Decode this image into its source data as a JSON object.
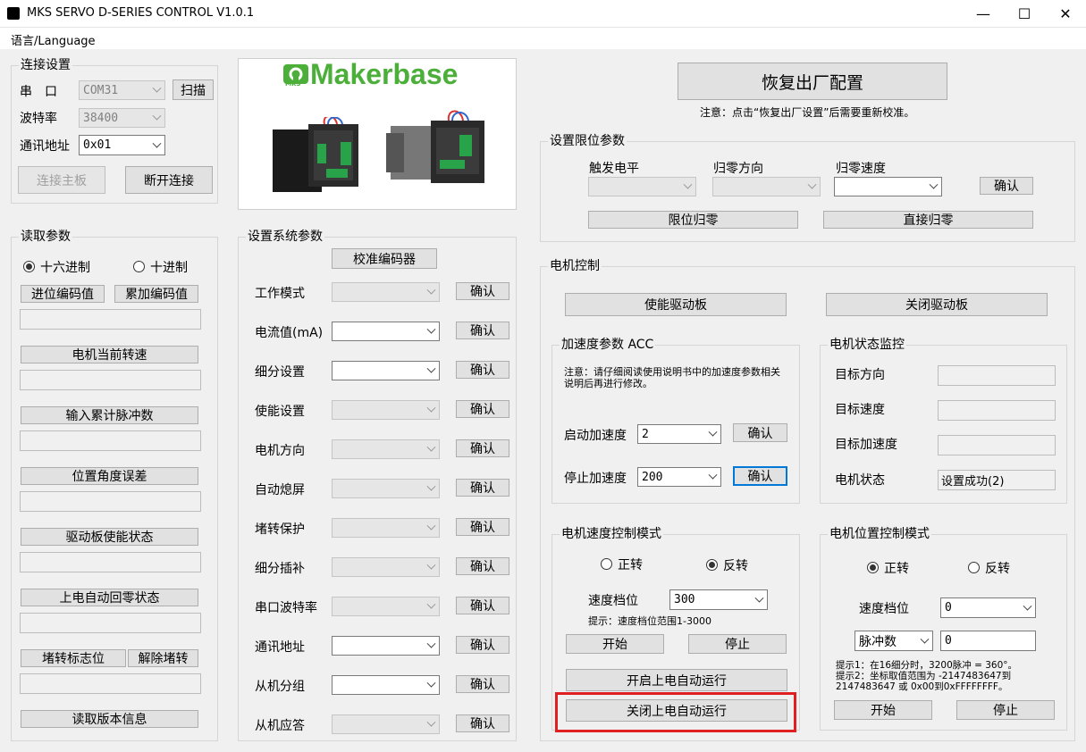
{
  "window": {
    "title": "MKS SERVO D-SERIES CONTROL V1.0.1",
    "minimize": "—",
    "maximize": "☐",
    "close": "✕"
  },
  "menu": {
    "language": "语言/Language"
  },
  "connection": {
    "group_label": "连接设置",
    "port_label": "串　口",
    "port_value": "COM31",
    "scan_button": "扫描",
    "baud_label": "波特率",
    "baud_value": "38400",
    "addr_label": "通讯地址",
    "addr_value": "0x01",
    "connect_button": "连接主板",
    "disconnect_button": "断开连接"
  },
  "logo": {
    "brand": "Makerbase",
    "badge": "MKS"
  },
  "read_params": {
    "group_label": "读取参数",
    "hex_label": "十六进制",
    "dec_label": "十进制",
    "carry_button": "进位编码值",
    "accum_button": "累加编码值",
    "speed_button": "电机当前转速",
    "pulses_button": "输入累计脉冲数",
    "angle_err_button": "位置角度误差",
    "enable_state_button": "驱动板使能状态",
    "auto_home_button": "上电自动回零状态",
    "stall_flag_button": "堵转标志位",
    "release_stall_button": "解除堵转",
    "version_button": "读取版本信息"
  },
  "system_params": {
    "group_label": "设置系统参数",
    "calibrate_button": "校准编码器",
    "confirm_label": "确认",
    "rows": [
      {
        "label": "工作模式"
      },
      {
        "label": "电流值(mA)"
      },
      {
        "label": "细分设置"
      },
      {
        "label": "使能设置"
      },
      {
        "label": "电机方向"
      },
      {
        "label": "自动熄屏"
      },
      {
        "label": "堵转保护"
      },
      {
        "label": "细分插补"
      },
      {
        "label": "串口波特率"
      },
      {
        "label": "通讯地址"
      },
      {
        "label": "从机分组"
      },
      {
        "label": "从机应答"
      }
    ]
  },
  "factory": {
    "button": "恢复出厂配置",
    "note": "注意：点击“恢复出厂设置”后需要重新校准。"
  },
  "limit": {
    "group_label": "设置限位参数",
    "trigger_label": "触发电平",
    "home_dir_label": "归零方向",
    "home_speed_label": "归零速度",
    "confirm_button": "确认",
    "limit_home_button": "限位归零",
    "direct_home_button": "直接归零"
  },
  "motor": {
    "group_label": "电机控制",
    "enable_button": "使能驱动板",
    "disable_button": "关闭驱动板",
    "acc": {
      "group_label": "加速度参数 ACC",
      "note": "注意：请仔细阅读使用说明书中的加速度参数相关说明后再进行修改。",
      "start_label": "启动加速度",
      "start_value": "2",
      "stop_label": "停止加速度",
      "stop_value": "200",
      "confirm_button": "确认"
    },
    "status": {
      "group_label": "电机状态监控",
      "target_dir_label": "目标方向",
      "target_speed_label": "目标速度",
      "target_acc_label": "目标加速度",
      "state_label": "电机状态",
      "state_value": "设置成功(2)"
    },
    "speed_mode": {
      "group_label": "电机速度控制模式",
      "forward_label": "正转",
      "reverse_label": "反转",
      "gear_label": "速度档位",
      "gear_value": "300",
      "hint": "提示：速度档位范围1-3000",
      "start_button": "开始",
      "stop_button": "停止",
      "auto_on_button": "开启上电自动运行",
      "auto_off_button": "关闭上电自动运行"
    },
    "pos_mode": {
      "group_label": "电机位置控制模式",
      "forward_label": "正转",
      "reverse_label": "反转",
      "gear_label": "速度档位",
      "gear_value": "0",
      "pulse_label": "脉冲数",
      "pulse_value": "0",
      "hint1": "提示1：在16细分时，3200脉冲 = 360°。",
      "hint2": "提示2：坐标取值范围为 -2147483647到2147483647 或 0x00到0xFFFFFFFF。",
      "start_button": "开始",
      "stop_button": "停止"
    }
  },
  "colors": {
    "highlight": "#e02020",
    "accent": "#0078d7",
    "logo_green": "#4caf3a"
  }
}
